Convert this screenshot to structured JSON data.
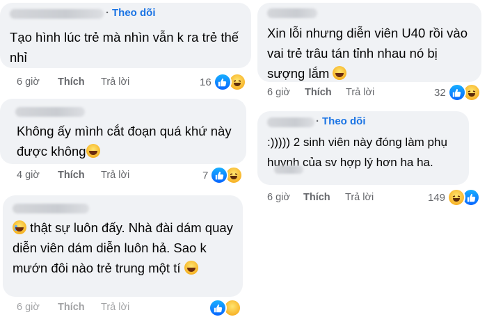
{
  "comments": [
    {
      "follow": "Theo dõi",
      "text": "Tạo hình lúc trẻ mà nhìn vẫn k ra trẻ thế nhỉ",
      "time": "6 giờ",
      "like": "Thích",
      "reply": "Trả lời",
      "count": "16",
      "reactions": [
        "like-icon",
        "haha-icon"
      ]
    },
    {
      "text": "Không ấy mình cắt đoạn quá khứ này được không",
      "time": "4 giờ",
      "like": "Thích",
      "reply": "Trả lời",
      "count": "7",
      "reactions": [
        "like-icon",
        "haha-icon"
      ]
    },
    {
      "text": "thật sự luôn đấy. Nhà đài dám quay diễn viên dám diễn luôn hả. Sao k mướn đôi nào trẻ trung một tí",
      "time": "6 giờ",
      "like": "Thích",
      "reply": "Trả lời",
      "reactions": [
        "like-icon",
        "haha-icon"
      ]
    },
    {
      "text": "Xin lỗi nhưng diễn viên U40 rồi vào vai trẻ trâu tán tỉnh nhau nó bị sượng lắm",
      "time": "6 giờ",
      "like": "Thích",
      "reply": "Trả lời",
      "count": "32",
      "reactions": [
        "like-icon",
        "haha-icon"
      ]
    },
    {
      "follow": "Theo dõi",
      "text": ":))))) 2 sinh viên này đóng làm phụ huynh của sv hợp lý hơn ha ha.",
      "time": "6 giờ",
      "like": "Thích",
      "reply": "Trả lời",
      "count": "149",
      "reactions": [
        "haha-icon",
        "like-icon"
      ]
    }
  ],
  "colors": {
    "bubble": "#f0f2f5",
    "link": "#1b74e4",
    "meta": "#65676b",
    "like": "#0866ff",
    "haha": "#f7b125"
  }
}
